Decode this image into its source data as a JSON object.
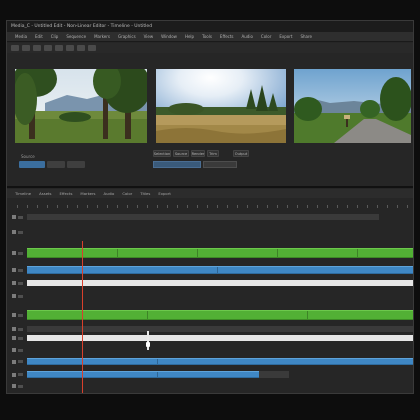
{
  "window": {
    "title": "Media_C - Untitled Edit - Non-Linear Editor - Timeline - Untitled"
  },
  "menu": {
    "items": [
      "Media",
      "Edit",
      "Clip",
      "Sequence",
      "Markers",
      "Graphics",
      "View",
      "Window",
      "Help",
      "Tools",
      "Effects",
      "Audio",
      "Color",
      "Export",
      "Share"
    ]
  },
  "viewer": {
    "label": "Source",
    "controls": [
      "Selection",
      "Source",
      "Render",
      "Trim",
      "Output"
    ],
    "thumbnails": [
      {
        "name": "forest-meadow"
      },
      {
        "name": "dry-field-trees"
      },
      {
        "name": "country-road"
      }
    ]
  },
  "timeline": {
    "tabs": [
      "Timeline",
      "Assets",
      "Effects",
      "Markers",
      "Audio",
      "Color",
      "Titles",
      "Export"
    ]
  },
  "colors": {
    "video_clip": "#52b035",
    "audio_clip": "#3f87c4",
    "playhead": "#d8402c",
    "accent": "#3b6e9e"
  }
}
